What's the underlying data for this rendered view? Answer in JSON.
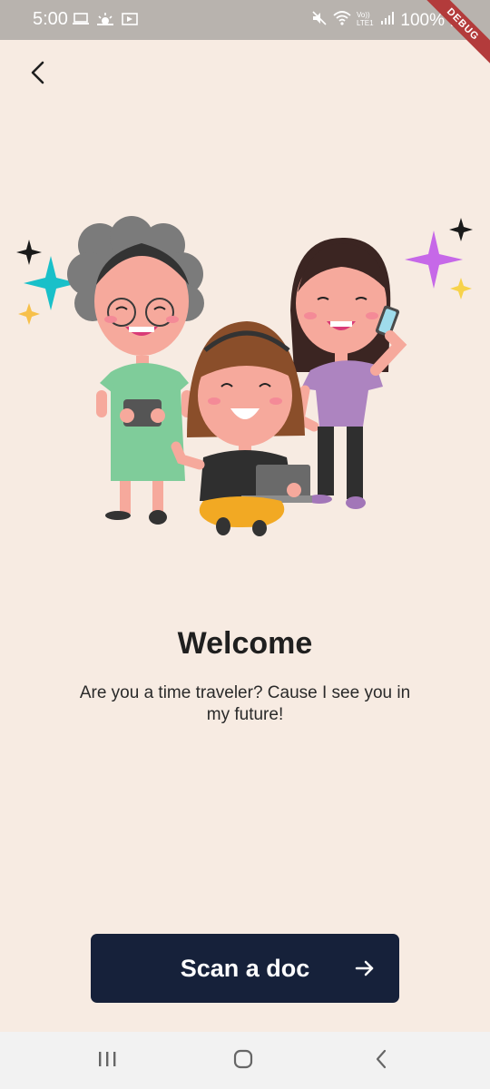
{
  "status_bar": {
    "time": "5:00",
    "battery": "100%",
    "left_icons": [
      "laptop-icon",
      "weather-icon",
      "cast-icon"
    ],
    "right_icons": [
      "mute-icon",
      "wifi-icon",
      "volte-icon",
      "signal-icon",
      "battery-icon"
    ]
  },
  "debug_banner": "DEBUG",
  "header": {
    "back_icon": "chevron-left-icon"
  },
  "illustration": {
    "description_icon": "welcome-people-illustration"
  },
  "main": {
    "title": "Welcome",
    "subtitle": "Are you a time traveler? Cause I see you in my future!"
  },
  "cta": {
    "label": "Scan a doc",
    "icon": "arrow-right-icon"
  },
  "nav_bar": {
    "icons": [
      "recents-icon",
      "home-icon",
      "back-icon"
    ]
  },
  "colors": {
    "background": "#f7ebe2",
    "status_bar": "#b8b3ae",
    "button": "#16213a",
    "button_text": "#ffffff",
    "nav_bar": "#f2f2f2"
  }
}
